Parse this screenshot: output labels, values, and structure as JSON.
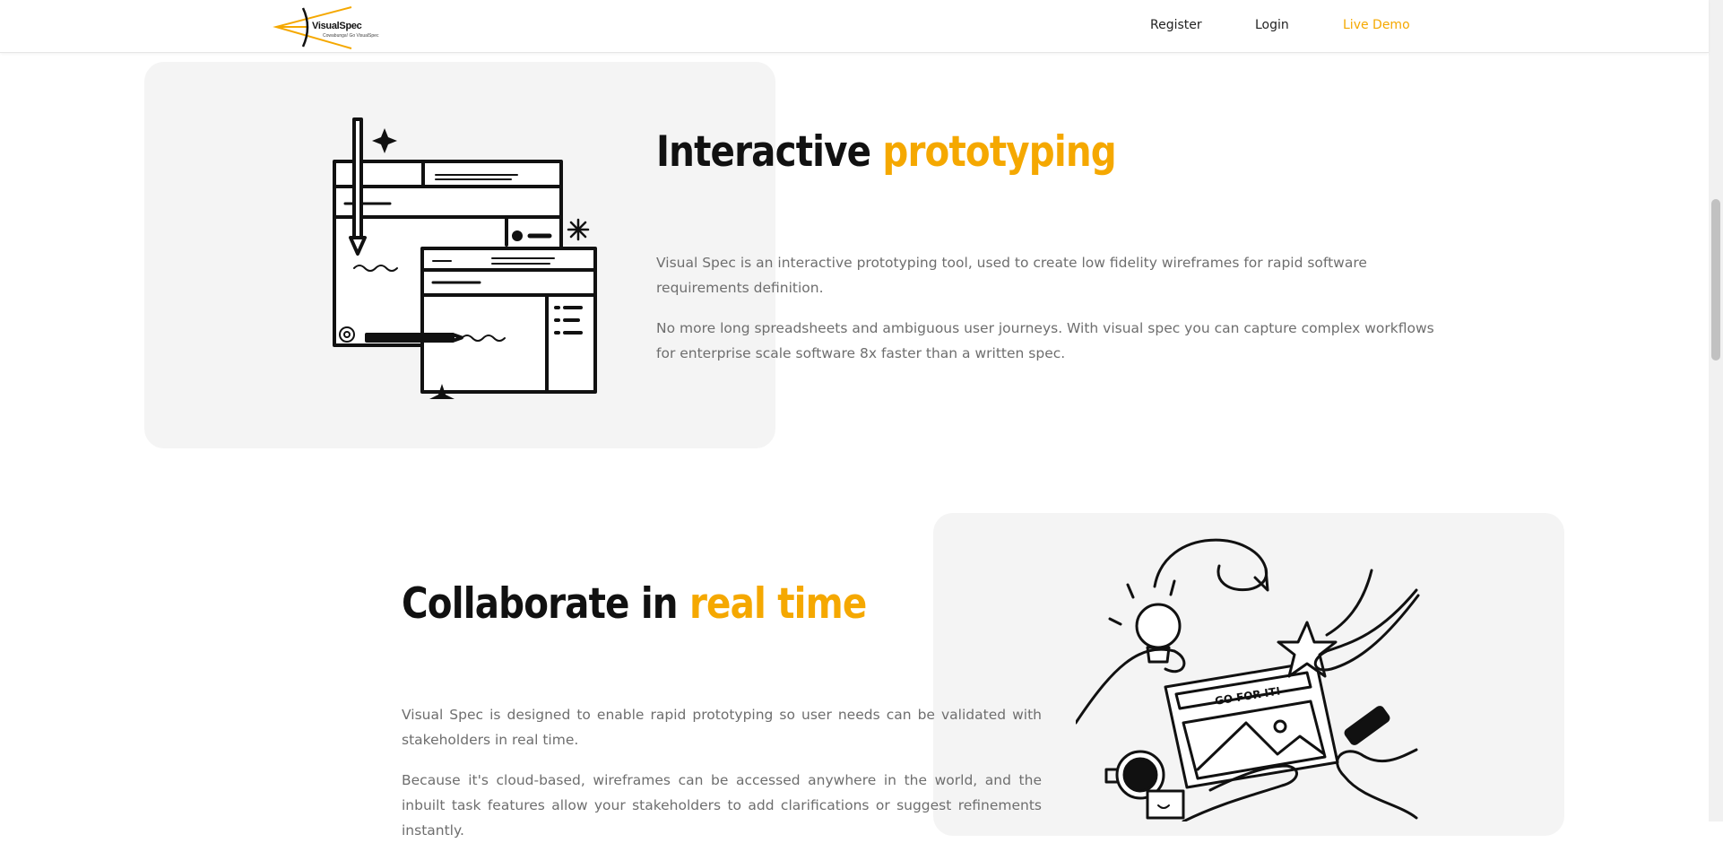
{
  "header": {
    "logo_text": "VisualSpec",
    "logo_tagline": "Cowabunga! Go VisualSpec",
    "nav": {
      "register": "Register",
      "login": "Login",
      "live_demo": "Live Demo"
    }
  },
  "sections": [
    {
      "title_plain": "Interactive ",
      "title_highlight": "prototyping",
      "paragraphs": [
        "Visual Spec is an interactive prototyping tool, used to create low fidelity wireframes for rapid software requirements definition.",
        "No more long spreadsheets and ambiguous user journeys. With visual spec you can capture complex workflows for enterprise scale software 8x faster than a written spec."
      ],
      "illustration": "wireframe-windows-illustration"
    },
    {
      "title_plain": "Collaborate in ",
      "title_highlight": "real time",
      "paragraphs": [
        "Visual Spec is designed to enable rapid prototyping so user needs can be validated with stakeholders in real time.",
        "Because it's cloud-based, wireframes can be accessed anywhere in the world, and the inbuilt task features allow your stakeholders to add clarifications or suggest refinements instantly."
      ],
      "illustration": "collaboration-hands-illustration",
      "illustration_text": "GO FOR IT!"
    }
  ],
  "colors": {
    "accent": "#f5a800",
    "card_bg": "#f4f4f4",
    "body_text": "#6e6e6e",
    "heading": "#111111"
  }
}
